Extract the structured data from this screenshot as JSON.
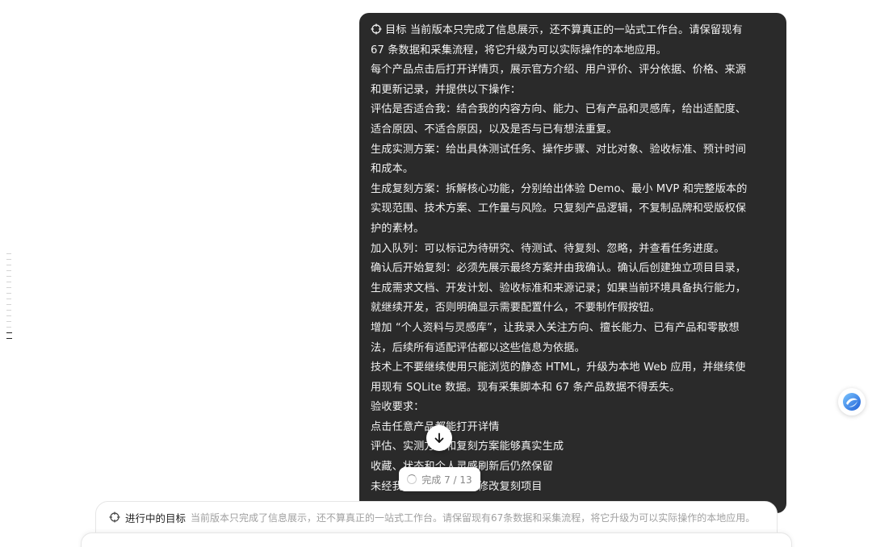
{
  "message": {
    "lines": [
      "目标 当前版本只完成了信息展示，还不算真正的一站式工作台。请保留现有",
      "67 条数据和采集流程，将它升级为可以实际操作的本地应用。",
      "每个产品点击后打开详情页，展示官方介绍、用户评价、评分依据、价格、来源",
      "和更新记录，并提供以下操作：",
      "评估是否适合我：结合我的内容方向、能力、已有产品和灵感库，给出适配度、",
      "适合原因、不适合原因，以及是否与已有想法重复。",
      "生成实测方案：给出具体测试任务、操作步骤、对比对象、验收标准、预计时间",
      "和成本。",
      "生成复刻方案：拆解核心功能，分别给出体验 Demo、最小 MVP 和完整版本的",
      "实现范围、技术方案、工作量与风险。只复刻产品逻辑，不复制品牌和受版权保",
      "护的素材。",
      "加入队列：可以标记为待研究、待测试、待复刻、忽略，并查看任务进度。",
      "确认后开始复刻：必须先展示最终方案并由我确认。确认后创建独立项目目录，",
      "生成需求文档、开发计划、验收标准和来源记录；如果当前环境具备执行能力，",
      "就继续开发，否则明确显示需要配置什么，不要制作假按钮。",
      "增加 “个人资料与灵感库”，让我录入关注方向、擅长能力、已有产品和零散想",
      "法，后续所有适配评估都以这些信息为依据。",
      "技术上不要继续使用只能浏览的静态 HTML，升级为本地 Web 应用，并继续使",
      "用现有 SQLite 数据。现有采集脚本和 67 条产品数据不得丢失。",
      "验收要求：",
      "点击任意产品都能打开详情",
      "评估、实测方案和复刻方案能够真实生成",
      "收藏、状态和个人灵感刷新后仍然保留",
      "未经我确认不得创建或修改复刻项目"
    ]
  },
  "progress": {
    "label": "完成 7 / 13"
  },
  "goal_bar": {
    "label": "进行中的目标",
    "text": "当前版本只完成了信息展示，还不算真正的一站式工作台。请保留现有67条数据和采集流程，将它升级为可以实际操作的本地应用。"
  },
  "icons": {
    "goal": "crosshair-icon",
    "scroll_down": "arrow-down-icon",
    "spinner": "loading-spinner-icon",
    "assistant": "assistant-logo-icon"
  },
  "colors": {
    "bubble_bg": "#2a2a2a",
    "bubble_text": "#f2f2f2",
    "muted_text": "#a0a0a0",
    "accent_blue": "#2f7de1"
  }
}
